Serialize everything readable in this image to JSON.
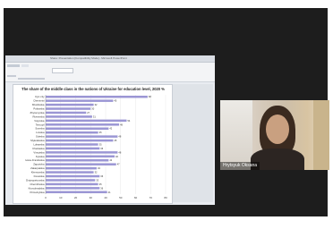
{
  "window": {
    "title": "Share: Presentation [Compatibility Mode] - Microsoft PowerPoint"
  },
  "participant": {
    "name": "Hrytsyuk Oksana"
  },
  "chart_data": {
    "type": "bar",
    "orientation": "horizontal",
    "title": "The share of the middle class in the nations of Ukraine for education level, 2020 %",
    "categories": [
      "Kyiv city",
      "Chernivtsi",
      "Kharkivska",
      "Poltavska",
      "Zhytomyrska",
      "Rivnenska",
      "Volynska",
      "Ternopil",
      "Sumska",
      "Lvivska",
      "Odeska",
      "Mykolaivska",
      "Luhanska",
      "Cherkaska",
      "Vinnytska",
      "Kyivska",
      "Ivano-Frankivska",
      "Zaporizka",
      "Zakarpatska",
      "Khersonska",
      "Donetska",
      "Dnipropetrovska",
      "Chernihivska",
      "Kirovohradska",
      "Khmelnytska"
    ],
    "values": [
      68,
      45,
      32,
      30,
      27,
      31,
      54,
      49,
      42,
      35,
      48,
      45,
      35,
      36,
      48,
      46,
      42,
      47,
      34,
      32,
      36,
      33,
      35,
      36,
      41
    ],
    "xlim": [
      0,
      80
    ],
    "xticks": [
      "0",
      "10",
      "20",
      "30",
      "40",
      "50",
      "60",
      "70",
      "80"
    ],
    "bar_color": "#9b96d4"
  }
}
